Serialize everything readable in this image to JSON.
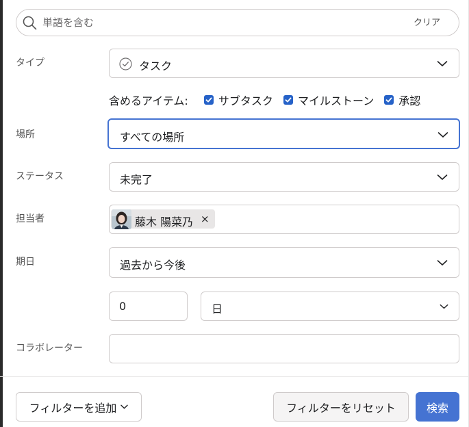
{
  "search": {
    "placeholder": "単語を含む",
    "clear_label": "クリア"
  },
  "fields": {
    "type": {
      "label": "タイプ",
      "value": "タスク"
    },
    "include": {
      "label": "含めるアイテム:",
      "items": [
        {
          "label": "サブタスク",
          "checked": true
        },
        {
          "label": "マイルストーン",
          "checked": true
        },
        {
          "label": "承認",
          "checked": true
        }
      ]
    },
    "location": {
      "label": "場所",
      "value": "すべての場所"
    },
    "status": {
      "label": "ステータス",
      "value": "未完了"
    },
    "assignee": {
      "label": "担当者",
      "chip_name": "藤木 陽菜乃",
      "remove": "×"
    },
    "due": {
      "label": "期日",
      "value": "過去から今後",
      "number": "0",
      "unit": "日"
    },
    "collaborators": {
      "label": "コラボレーター",
      "value": ""
    }
  },
  "footer": {
    "add_filter": "フィルターを追加",
    "reset": "フィルターをリセット",
    "search": "検索"
  },
  "colors": {
    "accent": "#4573d2",
    "checkbox": "#2662c8",
    "border": "#cfcbcb"
  }
}
